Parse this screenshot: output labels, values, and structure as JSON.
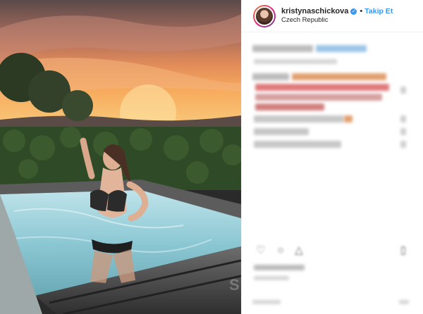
{
  "header": {
    "username": "kristynaschickova",
    "follow_label": "Takip Et",
    "dot": "•",
    "location": "Czech Republic"
  },
  "icons": {
    "verified": "verified-badge-icon",
    "like": "heart-icon",
    "comment": "comment-icon",
    "share": "share-icon",
    "save": "bookmark-icon"
  },
  "colors": {
    "accent": "#3897f0",
    "text": "#262626"
  }
}
